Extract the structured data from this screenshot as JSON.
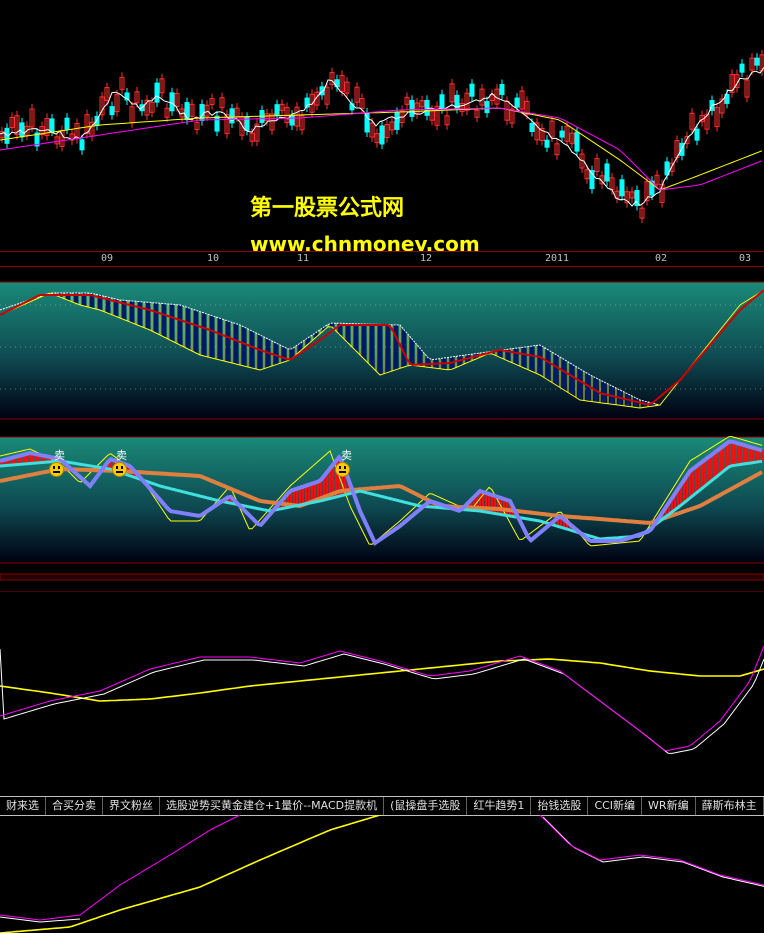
{
  "watermark": {
    "title": "第一股票公式网",
    "url": "www.chnmoney.com"
  },
  "time_axis": {
    "labels": [
      "09",
      "10",
      "11",
      "12",
      "2011",
      "02",
      "03"
    ]
  },
  "signals": {
    "sell_label": "卖"
  },
  "tabs": [
    "财来选",
    "合买分卖",
    "界文粉丝",
    "选股逆势买黄金建仓+1量价--MACD提款机",
    "(鼠操盘手选股",
    "红牛趋势1",
    "抬钱选股",
    "CCI新编",
    "WR新编",
    "薛斯布林主"
  ],
  "colors": {
    "candle_up": "#ff3030",
    "candle_down": "#00ffff",
    "ma_white": "#ffffff",
    "ma_magenta": "#ff00ff",
    "ma_yellow": "#ffff00",
    "red_line": "#cc0000",
    "navy_fill": "#001a66",
    "orange_line": "#e08040",
    "blue_line": "#8080ff",
    "cyan_line": "#40e0e0",
    "teal_bg": "#1a7a6a"
  }
}
